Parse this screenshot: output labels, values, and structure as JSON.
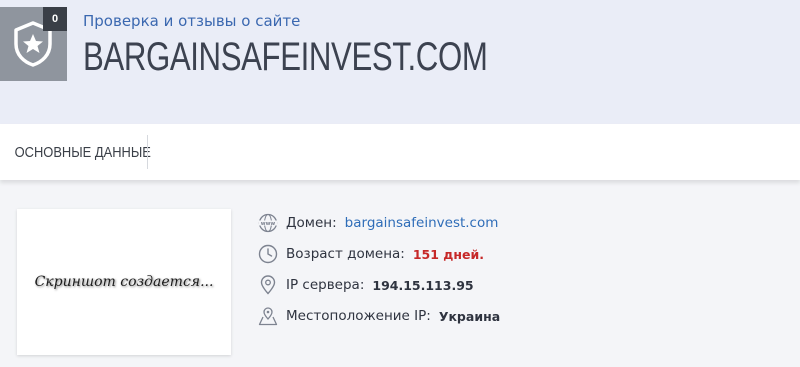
{
  "header": {
    "badge_count": "0",
    "subtitle": "Проверка и отзывы о сайте",
    "site_title": "BARGAINSAFEINVEST.COM"
  },
  "tabs": [
    {
      "label": "ОСНОВНЫЕ ДАННЫЕ"
    }
  ],
  "preview": {
    "placeholder": "Скриншот создается..."
  },
  "info": {
    "domain_label": "Домен:",
    "domain_value": "bargainsafeinvest.com",
    "age_label": "Возраст домена:",
    "age_value": "151 дней.",
    "ip_label": "IP сервера:",
    "ip_value": "194.15.113.95",
    "location_label": "Местоположение IP:",
    "location_value": "Украина"
  },
  "colors": {
    "header_bg": "#eaedf7",
    "shield_bg": "#8f959e",
    "link": "#2f6db8",
    "accent_red": "#c62828"
  },
  "icons": [
    "shield-star-icon",
    "www-icon",
    "clock-icon",
    "pin-icon",
    "map-pin-icon"
  ]
}
